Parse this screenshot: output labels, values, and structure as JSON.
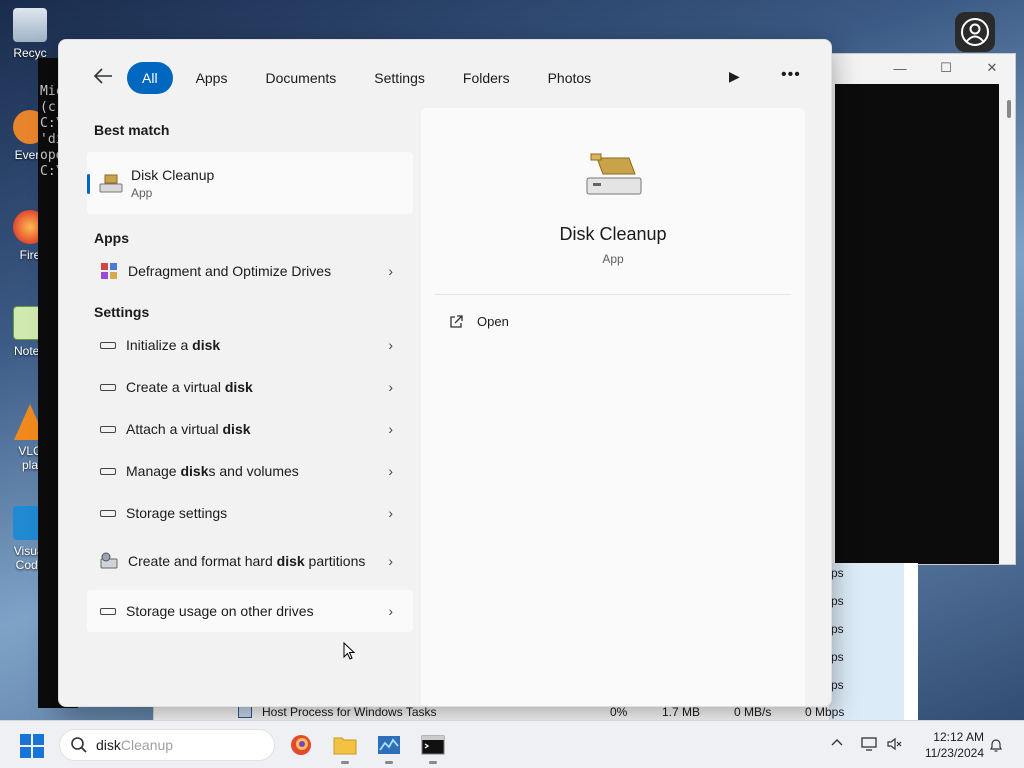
{
  "desktop": {
    "icons": [
      {
        "label": "Recyc",
        "icon": "recycle-bin-icon"
      },
      {
        "label": "Every",
        "icon": "everything-app-icon"
      },
      {
        "label": "Fire",
        "icon": "firefox-icon"
      },
      {
        "label": "Notep",
        "icon": "notepad-icon"
      },
      {
        "label": "VLC",
        "label2": "pla",
        "icon": "vlc-icon"
      },
      {
        "label": "Visual",
        "label2": "Code",
        "icon": "vscode-icon"
      }
    ]
  },
  "cmd": {
    "lines": [
      "Mic",
      "(c)",
      "",
      "C:\\",
      "'di",
      "ope",
      "",
      "C:\\"
    ]
  },
  "task_manager": {
    "mbps_labels": [
      "ps",
      "ps",
      "ps",
      "ps",
      "ps"
    ],
    "row": {
      "name": "Host Process for Windows Tasks",
      "cpu": "0%",
      "memory": "1.7 MB",
      "disk": "0 MB/s",
      "network": "0 Mbps"
    }
  },
  "search": {
    "filters": [
      "All",
      "Apps",
      "Documents",
      "Settings",
      "Folders",
      "Photos"
    ],
    "active_filter": "All",
    "best_match_title": "Best match",
    "best_match": {
      "name": "Disk Cleanup",
      "type": "App"
    },
    "apps_title": "Apps",
    "apps": [
      {
        "label": "Defragment and Optimize Drives"
      }
    ],
    "settings_title": "Settings",
    "settings": [
      {
        "pre": "Initialize a ",
        "bold": "disk",
        "post": ""
      },
      {
        "pre": "Create a virtual ",
        "bold": "disk",
        "post": ""
      },
      {
        "pre": "Attach a virtual ",
        "bold": "disk",
        "post": ""
      },
      {
        "pre": "Manage ",
        "bold": "disk",
        "post": "s and volumes"
      },
      {
        "pre": "Storage settings",
        "bold": "",
        "post": ""
      },
      {
        "pre": "Create and format hard ",
        "bold": "disk",
        "post": " partitions"
      },
      {
        "pre": "Storage usage on other drives",
        "bold": "",
        "post": ""
      }
    ],
    "detail": {
      "title": "Disk Cleanup",
      "type": "App",
      "action": "Open"
    }
  },
  "taskbar": {
    "search_query": "disk",
    "search_ghost": " Cleanup",
    "time": "12:12 AM",
    "date": "11/23/2024"
  },
  "colors": {
    "accent": "#0067c0"
  }
}
